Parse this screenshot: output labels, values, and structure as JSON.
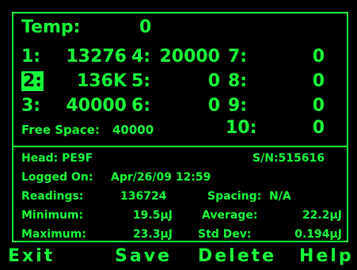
{
  "temp": {
    "label": "Temp:",
    "value": "0"
  },
  "channels": [
    {
      "num": "1:",
      "val": "13276"
    },
    {
      "num": "2:",
      "val": "136K"
    },
    {
      "num": "3:",
      "val": "40000"
    },
    {
      "num": "4:",
      "val": "20000"
    },
    {
      "num": "5:",
      "val": "0"
    },
    {
      "num": "6:",
      "val": "0"
    },
    {
      "num": "7:",
      "val": "0"
    },
    {
      "num": "8:",
      "val": "0"
    },
    {
      "num": "9:",
      "val": "0"
    },
    {
      "num": "10:",
      "val": "0"
    }
  ],
  "free_space": {
    "label": "Free Space:",
    "value": "40000"
  },
  "details": {
    "head": "Head: PE9F",
    "sn": "S/N:515616",
    "logged_label": "Logged On:",
    "logged_value": "Apr/26/09 12:59",
    "readings_label": "Readings:",
    "readings_value": "136724",
    "spacing_label": "Spacing:",
    "spacing_value": "N/A",
    "minimum_label": "Minimum:",
    "minimum_value": "19.5µJ",
    "average_label": "Average:",
    "average_value": "22.2µJ",
    "maximum_label": "Maximum:",
    "maximum_value": "23.3µJ",
    "stddev_label": "Std Dev:",
    "stddev_value": "0.194µJ"
  },
  "softkeys": {
    "exit": "Exit",
    "save": "Save",
    "delete": "Delete",
    "help": "Help"
  },
  "colors": {
    "phosphor": "#18ff3a",
    "background": "#000000"
  }
}
